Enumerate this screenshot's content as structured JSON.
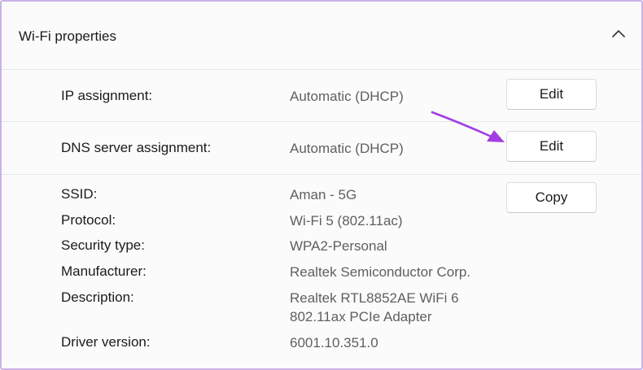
{
  "header": {
    "title": "Wi-Fi properties",
    "collapse_icon": "chevron-up-icon"
  },
  "ip_assignment": {
    "label": "IP assignment:",
    "value": "Automatic (DHCP)",
    "button": "Edit"
  },
  "dns_assignment": {
    "label": "DNS server assignment:",
    "value": "Automatic (DHCP)",
    "button": "Edit"
  },
  "details": {
    "copy_button": "Copy",
    "items": [
      {
        "label": "SSID:",
        "value": "Aman - 5G"
      },
      {
        "label": "Protocol:",
        "value": "Wi-Fi 5 (802.11ac)"
      },
      {
        "label": "Security type:",
        "value": "WPA2-Personal"
      },
      {
        "label": "Manufacturer:",
        "value": "Realtek Semiconductor Corp."
      },
      {
        "label": "Description:",
        "value_line1": "Realtek RTL8852AE WiFi 6",
        "value_line2": "802.11ax PCIe Adapter"
      },
      {
        "label": "Driver version:",
        "value": "6001.10.351.0"
      }
    ]
  },
  "annotation": {
    "arrow_color": "#a23ee0",
    "border_color": "#c9b3e6"
  }
}
